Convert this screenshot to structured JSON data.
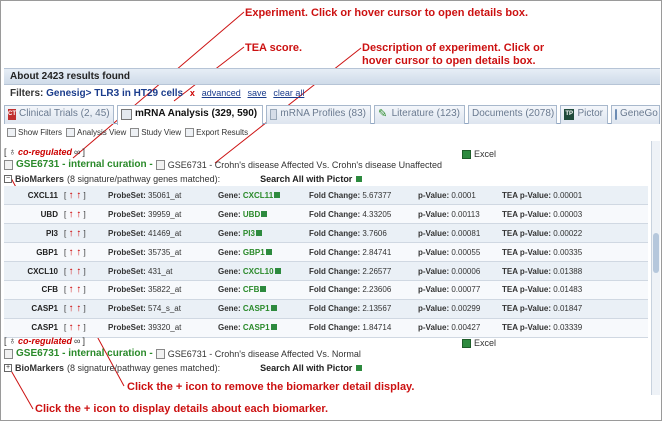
{
  "annotations": {
    "experiment": "Experiment. Click or hover cursor to open details box.",
    "tea_score": "TEA score.",
    "description_line1": "Description of experiment. Click or",
    "description_line2": "hover cursor to open details box.",
    "remove_biomarker": "Click the + icon to remove the biomarker detail display.",
    "display_biomarker": "Click the + icon to display details about each biomarker.",
    "color": "#cc1111"
  },
  "results": {
    "count_text": "About 2423 results found"
  },
  "filters": {
    "label": "Filters:",
    "value": "Genesig> TLR3 in HT29 cells",
    "remove": "x",
    "links": [
      "advanced",
      "save",
      "clear all"
    ]
  },
  "tabs": [
    {
      "label": "Clinical Trials (2, 45)",
      "icon": "clinical-trials-icon",
      "active": false
    },
    {
      "label": "mRNA Analysis (329, 590)",
      "icon": "mrna-analysis-icon",
      "active": true
    },
    {
      "label": "mRNA Profiles (83)",
      "icon": "mrna-profiles-icon",
      "active": false
    },
    {
      "label": "Literature (123)",
      "icon": "literature-icon",
      "active": false
    },
    {
      "label": "Documents (2078)",
      "icon": "documents-icon",
      "active": false
    },
    {
      "label": "Pictor",
      "icon": "pictor-icon",
      "active": false
    },
    {
      "label": "GeneGo",
      "icon": "genego-icon",
      "active": false
    }
  ],
  "toolbar": [
    "Show Filters",
    "Analysis View",
    "Study View",
    "Export Results"
  ],
  "experiments": [
    {
      "bracket_open": "[",
      "coregulated": "co-regulated",
      "infinity": "∞",
      "bracket_close": "]",
      "id_label": "GSE6731 - internal curation -",
      "description": "GSE6731 - Crohn's disease Affected Vs. Crohn's disease Unaffected",
      "excel": "Excel",
      "biomarkers_label": "BioMarkers",
      "biomarkers_count": "(8 signature/pathway genes matched):",
      "search_pictor": "Search All with Pictor",
      "expanded": true,
      "toggle_symbol": "−"
    },
    {
      "bracket_open": "[",
      "coregulated": "co-regulated",
      "infinity": "∞",
      "bracket_close": "]",
      "id_label": "GSE6731 - internal curation -",
      "description": "GSE6731 - Crohn's disease Affected Vs. Normal",
      "excel": "Excel",
      "biomarkers_label": "BioMarkers",
      "biomarkers_count": "(8 signature/pathway genes matched):",
      "search_pictor": "Search All with Pictor",
      "expanded": false,
      "toggle_symbol": "+"
    }
  ],
  "labels": {
    "probeset": "ProbeSet:",
    "gene": "Gene:",
    "fold_change": "Fold Change:",
    "pvalue": "p-Value:",
    "tea_pvalue": "TEA p-Value:"
  },
  "genes": [
    {
      "name": "CXCL11",
      "probeset": "35061_at",
      "gene": "CXCL11",
      "fold_change": "5.67377",
      "pvalue": "0.0001",
      "tea_pvalue": "0.00001"
    },
    {
      "name": "UBD",
      "probeset": "39959_at",
      "gene": "UBD",
      "fold_change": "4.33205",
      "pvalue": "0.00113",
      "tea_pvalue": "0.00003"
    },
    {
      "name": "PI3",
      "probeset": "41469_at",
      "gene": "PI3",
      "fold_change": "3.7606",
      "pvalue": "0.00081",
      "tea_pvalue": "0.00022"
    },
    {
      "name": "GBP1",
      "probeset": "35735_at",
      "gene": "GBP1",
      "fold_change": "2.84741",
      "pvalue": "0.00055",
      "tea_pvalue": "0.00335"
    },
    {
      "name": "CXCL10",
      "probeset": "431_at",
      "gene": "CXCL10",
      "fold_change": "2.26577",
      "pvalue": "0.00006",
      "tea_pvalue": "0.01388"
    },
    {
      "name": "CFB",
      "probeset": "35822_at",
      "gene": "CFB",
      "fold_change": "2.23606",
      "pvalue": "0.00077",
      "tea_pvalue": "0.01483"
    },
    {
      "name": "CASP1",
      "probeset": "574_s_at",
      "gene": "CASP1",
      "fold_change": "2.13567",
      "pvalue": "0.00299",
      "tea_pvalue": "0.01847"
    },
    {
      "name": "CASP1",
      "probeset": "39320_at",
      "gene": "CASP1",
      "fold_change": "1.84714",
      "pvalue": "0.00427",
      "tea_pvalue": "0.03339"
    }
  ],
  "symbols": {
    "bracket_open": "[",
    "bracket_close": "]",
    "up_arrows": "↑ ↑"
  }
}
